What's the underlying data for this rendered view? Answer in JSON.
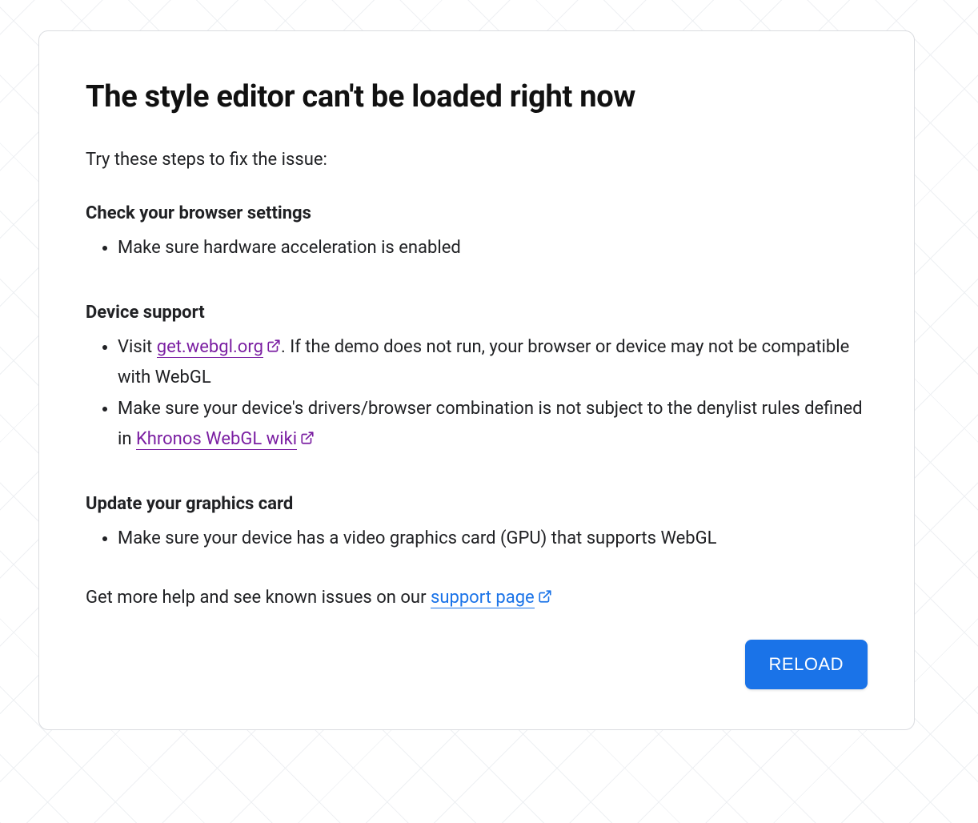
{
  "title": "The style editor can't be loaded right now",
  "intro": "Try these steps to fix the issue:",
  "sections": [
    {
      "heading": "Check your browser settings",
      "items": [
        {
          "text": "Make sure hardware acceleration is enabled"
        }
      ]
    },
    {
      "heading": "Device support",
      "items": [
        {
          "text_before": "Visit ",
          "link_text": "get.webgl.org",
          "link_visited": true,
          "text_after": ". If the demo does not run, your browser or device may not be compatible with WebGL"
        },
        {
          "text_before": "Make sure your device's drivers/browser combination is not subject to the denylist rules defined in ",
          "link_text": "Khronos WebGL wiki",
          "link_visited": true,
          "text_after": ""
        }
      ]
    },
    {
      "heading": "Update your graphics card",
      "items": [
        {
          "text": "Make sure your device has a video graphics card (GPU) that supports WebGL"
        }
      ]
    }
  ],
  "footer": {
    "text_before": "Get more help and see known issues on our ",
    "link_text": "support page",
    "link_visited": false
  },
  "reload_button": "RELOAD"
}
